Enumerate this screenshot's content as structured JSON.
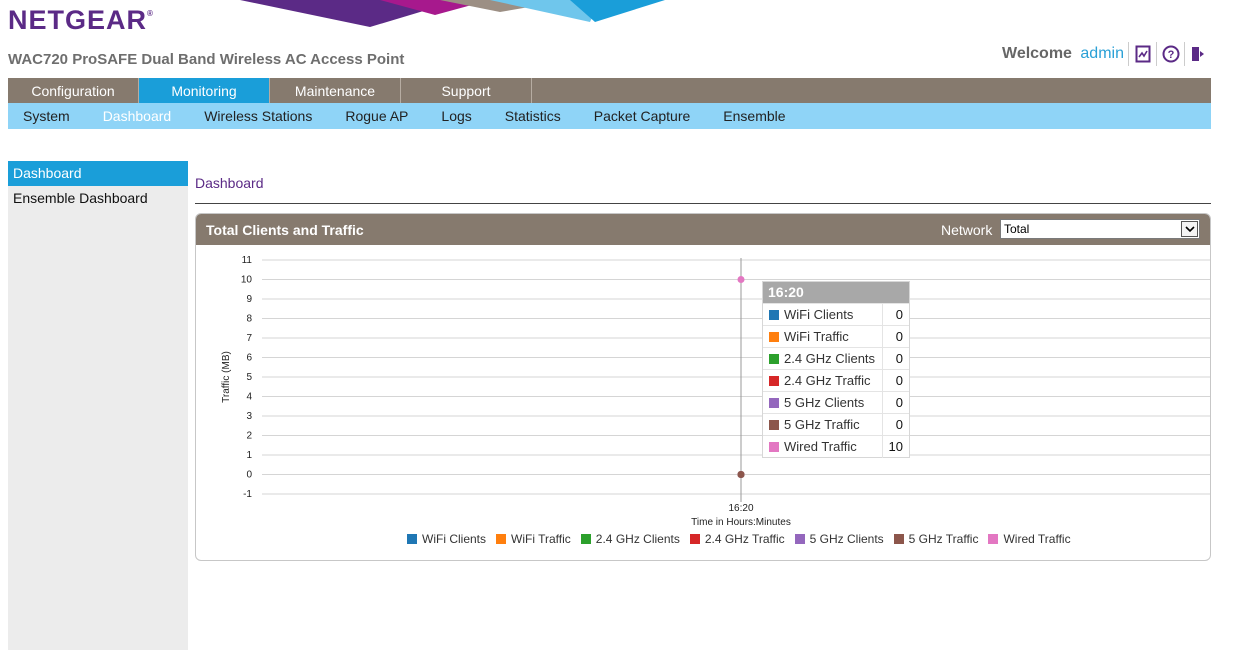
{
  "header": {
    "logo": "NETGEAR",
    "product_title": "WAC720 ProSAFE Dual Band Wireless AC Access Point",
    "welcome_label": "Welcome",
    "username": "admin",
    "icons": [
      "license-icon",
      "help-icon",
      "logout-icon"
    ]
  },
  "main_nav": {
    "tabs": [
      {
        "label": "Configuration",
        "active": false
      },
      {
        "label": "Monitoring",
        "active": true
      },
      {
        "label": "Maintenance",
        "active": false
      },
      {
        "label": "Support",
        "active": false
      }
    ]
  },
  "sub_nav": {
    "tabs": [
      {
        "label": "System",
        "active": false
      },
      {
        "label": "Dashboard",
        "active": true
      },
      {
        "label": "Wireless Stations",
        "active": false
      },
      {
        "label": "Rogue AP",
        "active": false
      },
      {
        "label": "Logs",
        "active": false
      },
      {
        "label": "Statistics",
        "active": false
      },
      {
        "label": "Packet Capture",
        "active": false
      },
      {
        "label": "Ensemble",
        "active": false
      }
    ]
  },
  "sidebar": {
    "items": [
      {
        "label": "Dashboard",
        "active": true
      },
      {
        "label": "Ensemble Dashboard",
        "active": false
      }
    ]
  },
  "content": {
    "breadcrumb": "Dashboard",
    "panel_title": "Total Clients and Traffic",
    "network_label": "Network",
    "network_value": "Total"
  },
  "tooltip": {
    "time": "16:20",
    "rows": [
      {
        "label": "WiFi Clients",
        "value": "0",
        "color": "#1f77b4"
      },
      {
        "label": "WiFi Traffic",
        "value": "0",
        "color": "#ff7f0e"
      },
      {
        "label": "2.4 GHz Clients",
        "value": "0",
        "color": "#2ca02c"
      },
      {
        "label": "2.4 GHz Traffic",
        "value": "0",
        "color": "#d62728"
      },
      {
        "label": "5 GHz Clients",
        "value": "0",
        "color": "#9467bd"
      },
      {
        "label": "5 GHz Traffic",
        "value": "0",
        "color": "#8c564b"
      },
      {
        "label": "Wired Traffic",
        "value": "10",
        "color": "#e377c2"
      }
    ]
  },
  "chart_data": {
    "type": "line",
    "title": "",
    "xlabel": "Time in Hours:Minutes",
    "ylabel": "Traffic (MB)",
    "ylim": [
      -1,
      11
    ],
    "yticks": [
      "11",
      "10",
      "9",
      "8",
      "7",
      "6",
      "5",
      "4",
      "3",
      "2",
      "1",
      "0",
      "-1"
    ],
    "x": [
      "16:20"
    ],
    "grid": true,
    "legend": "bottom",
    "series": [
      {
        "name": "WiFi Clients",
        "values": [
          0
        ],
        "color": "#1f77b4"
      },
      {
        "name": "WiFi Traffic",
        "values": [
          0
        ],
        "color": "#ff7f0e"
      },
      {
        "name": "2.4 GHz Clients",
        "values": [
          0
        ],
        "color": "#2ca02c"
      },
      {
        "name": "2.4 GHz Traffic",
        "values": [
          0
        ],
        "color": "#d62728"
      },
      {
        "name": "5 GHz Clients",
        "values": [
          0
        ],
        "color": "#9467bd"
      },
      {
        "name": "5 GHz Traffic",
        "values": [
          0
        ],
        "color": "#8c564b"
      },
      {
        "name": "Wired Traffic",
        "values": [
          10
        ],
        "color": "#e377c2"
      }
    ]
  }
}
